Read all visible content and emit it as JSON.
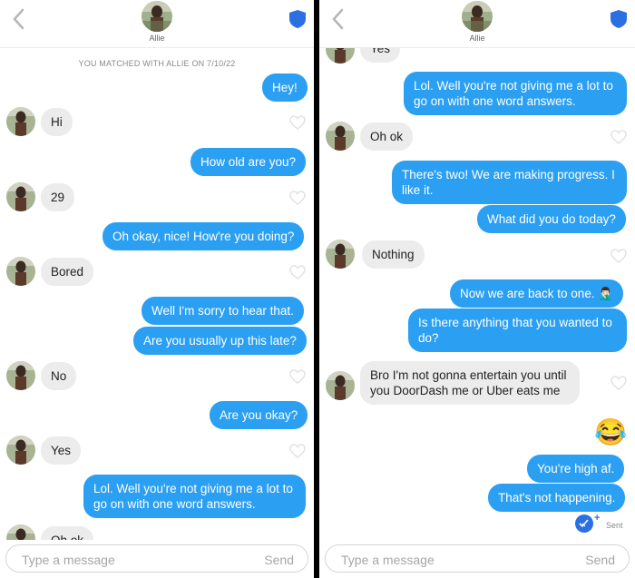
{
  "header": {
    "contact_name": "Allie"
  },
  "left": {
    "match_text": "YOU MATCHED WITH ALLIE ON 7/10/22",
    "messages": {
      "m1": "Hey!",
      "m2": "Hi",
      "m3": "How old are you?",
      "m4": "29",
      "m5": "Oh okay, nice! How're you doing?",
      "m6": "Bored",
      "m7": "Well I'm sorry to hear that.",
      "m8": "Are you usually up this late?",
      "m9": "No",
      "m10": "Are you okay?",
      "m11": "Yes",
      "m12": "Lol. Well you're not giving me a lot to go on with one word answers.",
      "m13": "Oh ok"
    }
  },
  "right": {
    "messages": {
      "m0": "Yes",
      "m1": "Lol. Well you're not giving me a lot to go on with one word answers.",
      "m2": "Oh ok",
      "m3": "There's two! We are making progress. I like it.",
      "m4": "What did you do today?",
      "m5": "Nothing",
      "m6": "Now we are back to one. 🤦🏻‍♂️",
      "m7": "Is there anything that you wanted to do?",
      "m8": "Bro I'm not gonna entertain you until you DoorDash me or Uber eats me",
      "m9": "😂",
      "m10": "You're high af.",
      "m11": "That's not happening."
    },
    "status": "Sent"
  },
  "composer": {
    "placeholder": "Type a message",
    "send_label": "Send"
  },
  "colors": {
    "outgoing": "#2b9ff2",
    "incoming": "#ececec",
    "accent": "#2b6fe3"
  }
}
